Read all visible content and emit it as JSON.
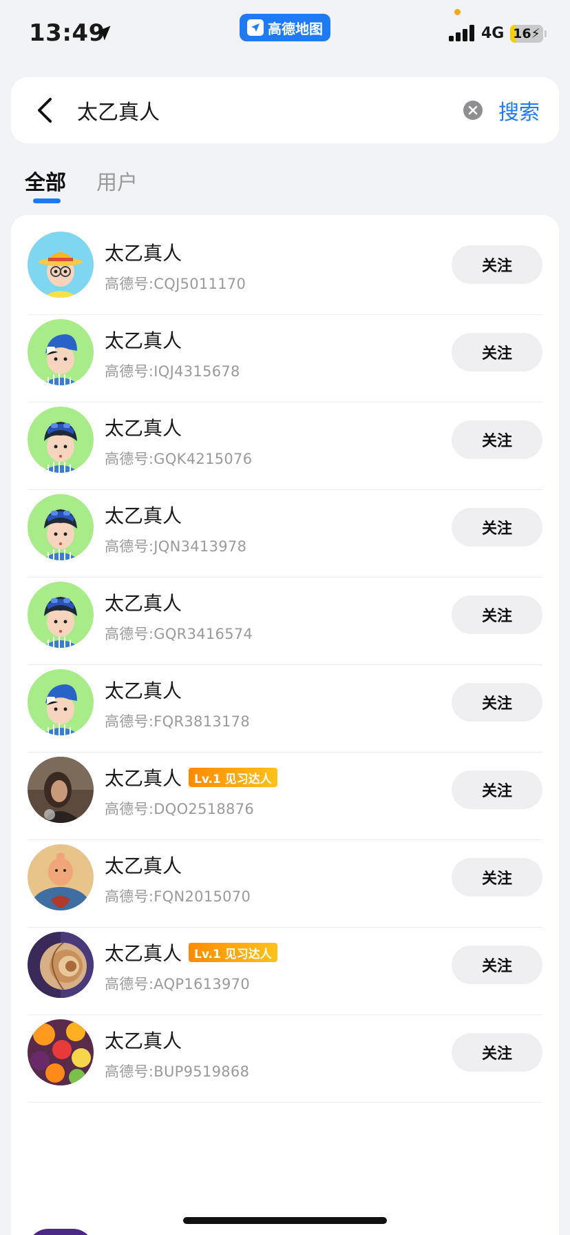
{
  "status_bar": {
    "time": "13:49",
    "network": "4G",
    "battery": "16",
    "battery_level_percent": 16,
    "app_name": "高德地图"
  },
  "search": {
    "query": "太乙真人",
    "submit_label": "搜索"
  },
  "tabs": [
    {
      "label": "全部",
      "active": true
    },
    {
      "label": "用户",
      "active": false
    }
  ],
  "results": [
    {
      "name": "太乙真人",
      "id_text": "高德号:CQJ5011170",
      "badge": "",
      "follow_label": "关注",
      "avatar": "cartoon-girl-hat"
    },
    {
      "name": "太乙真人",
      "id_text": "高德号:IQJ4315678",
      "badge": "",
      "follow_label": "关注",
      "avatar": "cartoon-boy-cap"
    },
    {
      "name": "太乙真人",
      "id_text": "高德号:GQK4215076",
      "badge": "",
      "follow_label": "关注",
      "avatar": "cartoon-boy-goggles"
    },
    {
      "name": "太乙真人",
      "id_text": "高德号:JQN3413978",
      "badge": "",
      "follow_label": "关注",
      "avatar": "cartoon-boy-goggles"
    },
    {
      "name": "太乙真人",
      "id_text": "高德号:GQR3416574",
      "badge": "",
      "follow_label": "关注",
      "avatar": "cartoon-boy-goggles"
    },
    {
      "name": "太乙真人",
      "id_text": "高德号:FQR3813178",
      "badge": "",
      "follow_label": "关注",
      "avatar": "cartoon-boy-cap"
    },
    {
      "name": "太乙真人",
      "id_text": "高德号:DQO2518876",
      "badge": "Lv.1 见习达人",
      "follow_label": "关注",
      "avatar": "photo-dark"
    },
    {
      "name": "太乙真人",
      "id_text": "高德号:FQN2015070",
      "badge": "",
      "follow_label": "关注",
      "avatar": "cartoon-taiyi"
    },
    {
      "name": "太乙真人",
      "id_text": "高德号:AQP1613970",
      "badge": "Lv.1 见习达人",
      "follow_label": "关注",
      "avatar": "nautilus-shell"
    },
    {
      "name": "太乙真人",
      "id_text": "高德号:BUP9519868",
      "badge": "",
      "follow_label": "关注",
      "avatar": "fruit-photo"
    }
  ],
  "colors": {
    "accent": "#1f7bf5",
    "background": "#f2f3f7",
    "badge_start": "#ff8a00",
    "badge_end": "#ffc21a"
  }
}
